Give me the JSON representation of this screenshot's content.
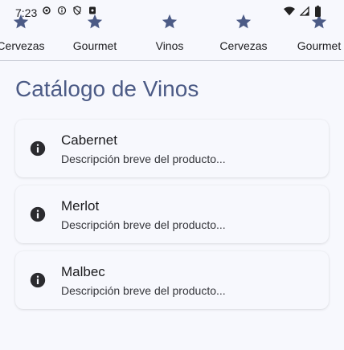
{
  "status_bar": {
    "time": "7:23",
    "left_icons": [
      "settings-icon",
      "info-icon",
      "shield-icon",
      "notification-icon"
    ],
    "right_icons": [
      "wifi-icon",
      "signal-icon",
      "battery-icon"
    ]
  },
  "tabs": [
    {
      "label": "Cervezas",
      "icon": "star-icon"
    },
    {
      "label": "Gourmet",
      "icon": "star-icon"
    },
    {
      "label": "Vinos",
      "icon": "star-icon"
    },
    {
      "label": "Cervezas",
      "icon": "star-icon"
    },
    {
      "label": "Gourmet",
      "icon": "star-icon"
    }
  ],
  "colors": {
    "accent": "#4c5b86",
    "background": "#f7f8fd",
    "icon_dark": "#2b2b2f"
  },
  "page": {
    "title": "Catálogo de Vinos"
  },
  "products": [
    {
      "name": "Cabernet",
      "description": "Descripción breve del producto..."
    },
    {
      "name": "Merlot",
      "description": "Descripción breve del producto..."
    },
    {
      "name": "Malbec",
      "description": "Descripción breve del producto..."
    }
  ]
}
